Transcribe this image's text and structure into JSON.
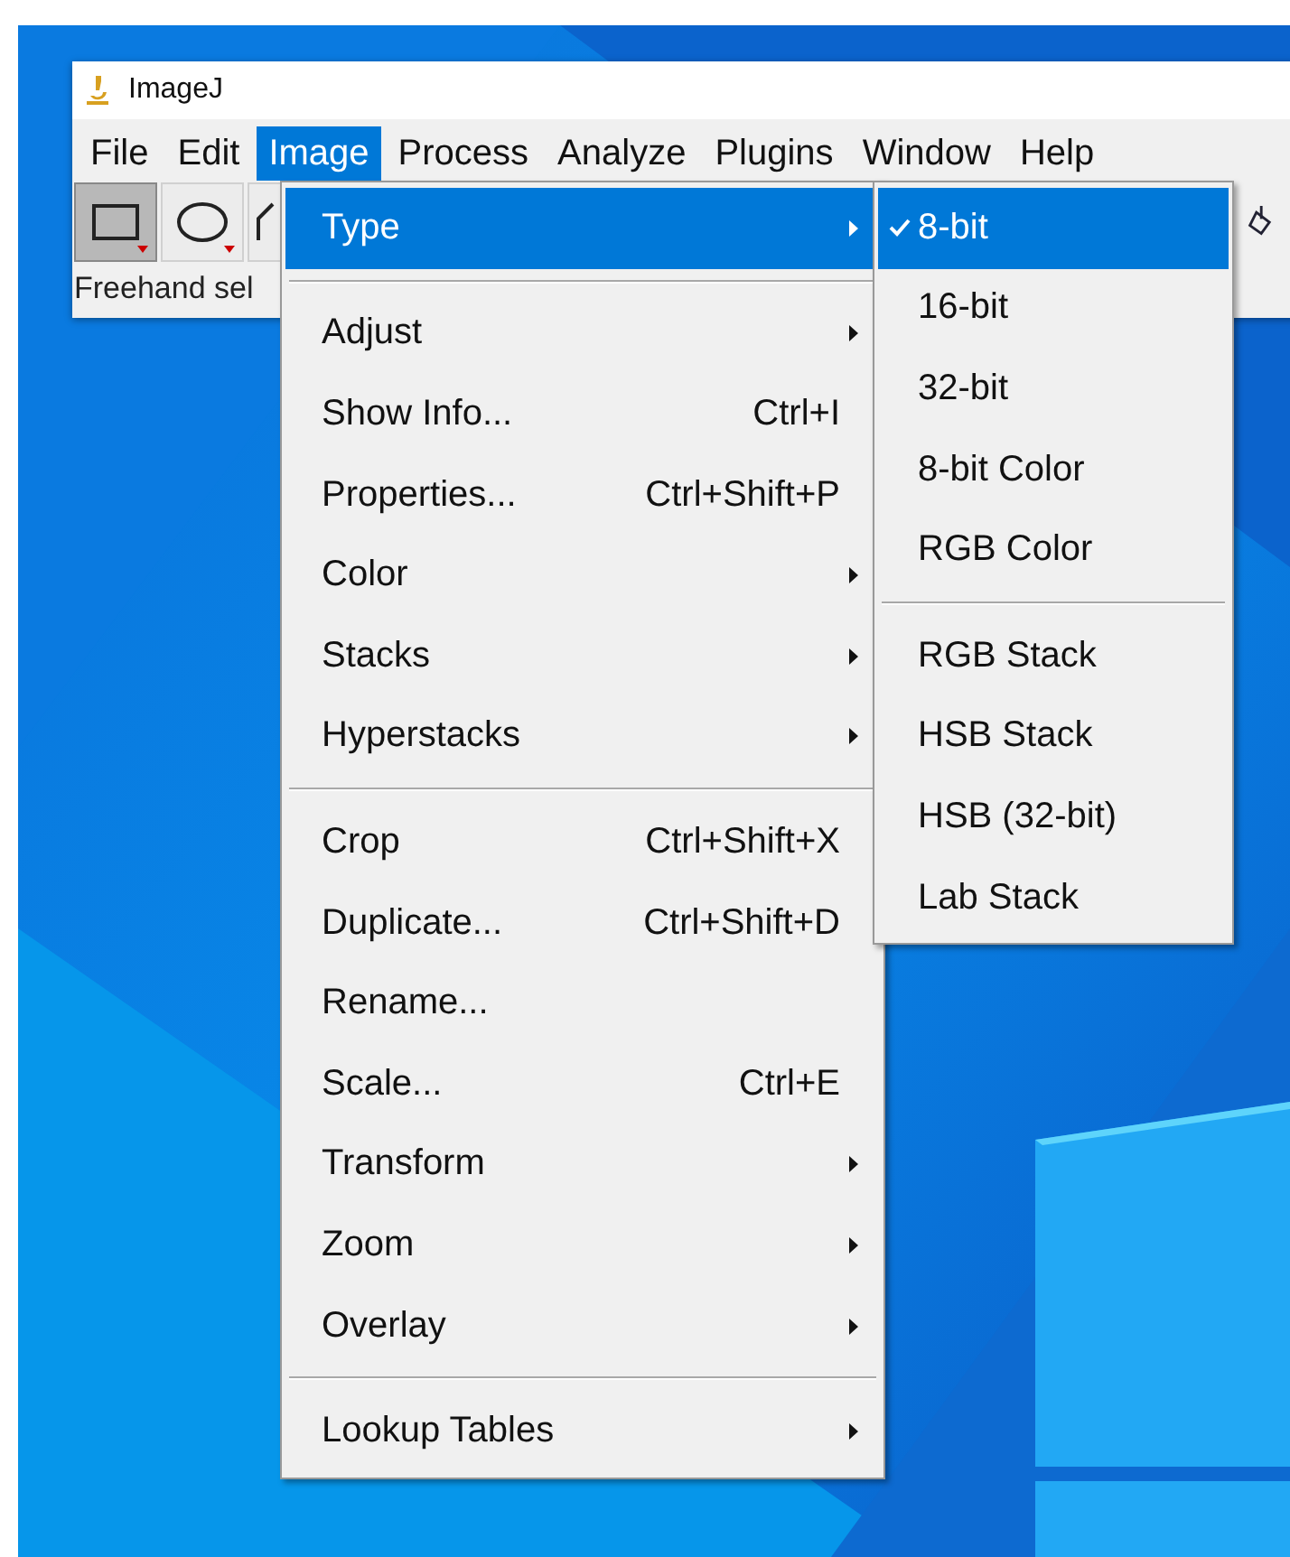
{
  "window": {
    "title": "ImageJ"
  },
  "menubar": [
    {
      "label": "File",
      "selected": false
    },
    {
      "label": "Edit",
      "selected": false
    },
    {
      "label": "Image",
      "selected": true
    },
    {
      "label": "Process",
      "selected": false
    },
    {
      "label": "Analyze",
      "selected": false
    },
    {
      "label": "Plugins",
      "selected": false
    },
    {
      "label": "Window",
      "selected": false
    },
    {
      "label": "Help",
      "selected": false
    }
  ],
  "toolbar": [
    {
      "kind": "rectangle",
      "selected": true
    },
    {
      "kind": "oval",
      "selected": false
    },
    {
      "kind": "polygon",
      "selected": false
    }
  ],
  "toolbar_right": [
    {
      "kind": "bucket"
    }
  ],
  "status_bar": "Freehand sel",
  "menu": [
    {
      "kind": "item",
      "label": "Type",
      "submenu": true,
      "selected": true
    },
    {
      "kind": "separator"
    },
    {
      "kind": "item",
      "label": "Adjust",
      "submenu": true,
      "selected": false
    },
    {
      "kind": "item",
      "label": "Show Info...",
      "shortcut": "Ctrl+I",
      "submenu": false,
      "selected": false
    },
    {
      "kind": "item",
      "label": "Properties...",
      "shortcut": "Ctrl+Shift+P",
      "submenu": false,
      "selected": false
    },
    {
      "kind": "item",
      "label": "Color",
      "submenu": true,
      "selected": false
    },
    {
      "kind": "item",
      "label": "Stacks",
      "submenu": true,
      "selected": false
    },
    {
      "kind": "item",
      "label": "Hyperstacks",
      "submenu": true,
      "selected": false
    },
    {
      "kind": "separator"
    },
    {
      "kind": "item",
      "label": "Crop",
      "shortcut": "Ctrl+Shift+X",
      "submenu": false,
      "selected": false
    },
    {
      "kind": "item",
      "label": "Duplicate...",
      "shortcut": "Ctrl+Shift+D",
      "submenu": false,
      "selected": false
    },
    {
      "kind": "item",
      "label": "Rename...",
      "submenu": false,
      "selected": false
    },
    {
      "kind": "item",
      "label": "Scale...",
      "shortcut": "Ctrl+E",
      "submenu": false,
      "selected": false
    },
    {
      "kind": "item",
      "label": "Transform",
      "submenu": true,
      "selected": false
    },
    {
      "kind": "item",
      "label": "Zoom",
      "submenu": true,
      "selected": false
    },
    {
      "kind": "item",
      "label": "Overlay",
      "submenu": true,
      "selected": false
    },
    {
      "kind": "separator"
    },
    {
      "kind": "item",
      "label": "Lookup Tables",
      "submenu": true,
      "selected": false
    }
  ],
  "type_submenu": [
    {
      "kind": "item",
      "label": "8-bit",
      "checked": true,
      "selected": true
    },
    {
      "kind": "item",
      "label": "16-bit",
      "checked": false,
      "selected": false
    },
    {
      "kind": "item",
      "label": "32-bit",
      "checked": false,
      "selected": false
    },
    {
      "kind": "item",
      "label": "8-bit Color",
      "checked": false,
      "selected": false
    },
    {
      "kind": "item",
      "label": "RGB Color",
      "checked": false,
      "selected": false
    },
    {
      "kind": "separator"
    },
    {
      "kind": "item",
      "label": "RGB Stack",
      "checked": false,
      "selected": false
    },
    {
      "kind": "item",
      "label": "HSB Stack",
      "checked": false,
      "selected": false
    },
    {
      "kind": "item",
      "label": "HSB (32-bit)",
      "checked": false,
      "selected": false
    },
    {
      "kind": "item",
      "label": "Lab Stack",
      "checked": false,
      "selected": false
    }
  ]
}
